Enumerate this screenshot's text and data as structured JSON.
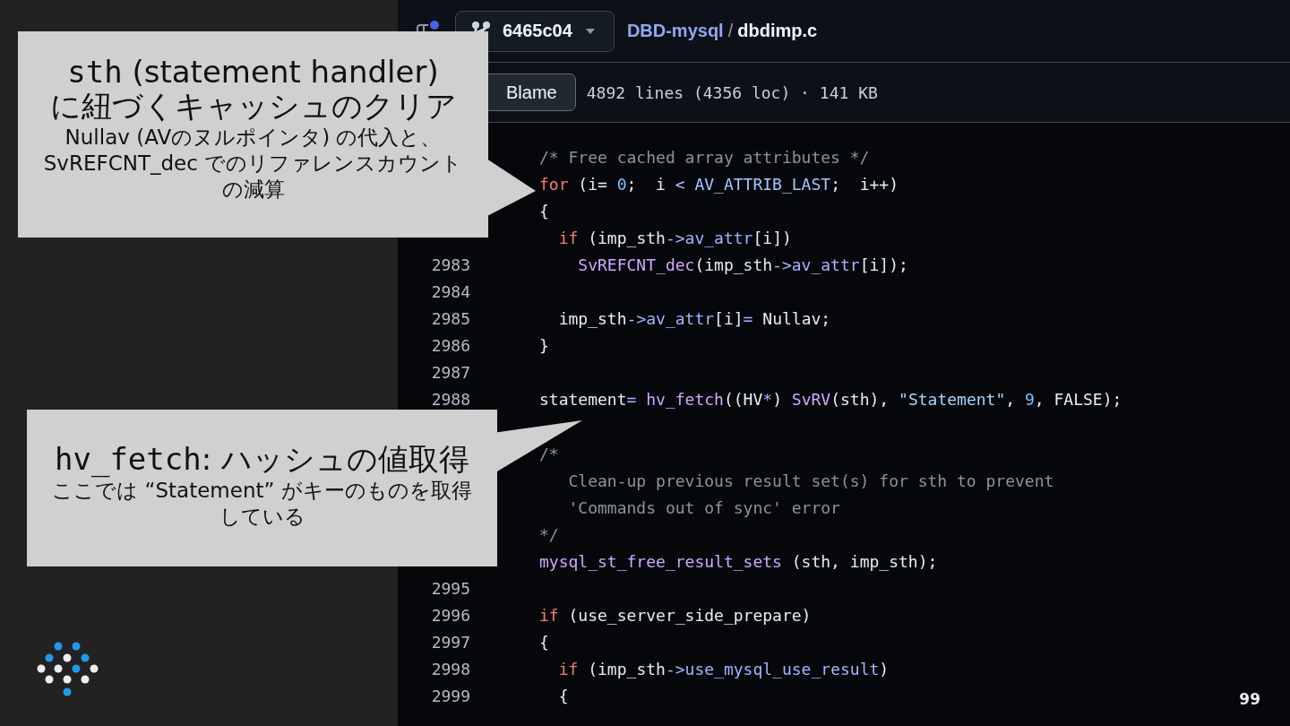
{
  "header": {
    "branch": "6465c04",
    "repo": "DBD-mysql",
    "separator": "/",
    "file": "dbdimp.c"
  },
  "file_bar": {
    "blame_button": "Blame",
    "info": "4892 lines (4356 loc) · 141 KB"
  },
  "code_lines": [
    {
      "tokens": [
        {
          "kind": "comment",
          "text": "/* Free cached array attributes */"
        }
      ]
    },
    {
      "tokens": [
        {
          "kind": "kw",
          "text": "for"
        },
        {
          "kind": "plain",
          "text": " (i= "
        },
        {
          "kind": "num",
          "text": "0"
        },
        {
          "kind": "plain",
          "text": ";  i "
        },
        {
          "kind": "const",
          "text": "< AV_ATTRIB_LAST"
        },
        {
          "kind": "plain",
          "text": ";  i++)"
        }
      ]
    },
    {
      "tokens": [
        {
          "kind": "plain",
          "text": "{"
        }
      ]
    },
    {
      "tokens": [
        {
          "kind": "kw",
          "text": "  if"
        },
        {
          "kind": "plain",
          "text": " (imp_sth"
        },
        {
          "kind": "prop",
          "text": "->av_attr"
        },
        {
          "kind": "plain",
          "text": "[i])"
        }
      ]
    },
    {
      "num": "2983",
      "tokens": [
        {
          "kind": "fn",
          "text": "    SvREFCNT_dec"
        },
        {
          "kind": "plain",
          "text": "(imp_sth"
        },
        {
          "kind": "prop",
          "text": "->av_attr"
        },
        {
          "kind": "plain",
          "text": "[i]);"
        }
      ]
    },
    {
      "num": "2984"
    },
    {
      "num": "2985",
      "tokens": [
        {
          "kind": "plain",
          "text": "  imp_sth"
        },
        {
          "kind": "prop",
          "text": "->av_attr"
        },
        {
          "kind": "plain",
          "text": "[i]"
        },
        {
          "kind": "prop",
          "text": "="
        },
        {
          "kind": "plain",
          "text": " Nullav;"
        }
      ]
    },
    {
      "num": "2986",
      "tokens": [
        {
          "kind": "plain",
          "text": "}"
        }
      ]
    },
    {
      "num": "2987"
    },
    {
      "num": "2988",
      "tokens": [
        {
          "kind": "plain",
          "text": "statement"
        },
        {
          "kind": "prop",
          "text": "="
        },
        {
          "kind": "fn",
          "text": " hv_fetch"
        },
        {
          "kind": "plain",
          "text": "((HV"
        },
        {
          "kind": "prop",
          "text": "*"
        },
        {
          "kind": "plain",
          "text": ") "
        },
        {
          "kind": "fn",
          "text": "SvRV"
        },
        {
          "kind": "plain",
          "text": "(sth), "
        },
        {
          "kind": "str",
          "text": "\"Statement\""
        },
        {
          "kind": "plain",
          "text": ", "
        },
        {
          "kind": "num",
          "text": "9"
        },
        {
          "kind": "plain",
          "text": ", FALSE);"
        }
      ]
    },
    {
      "tokens": [
        {
          "kind": "comment",
          "text": "/*"
        }
      ]
    },
    {
      "tokens": [
        {
          "kind": "comment",
          "text": "   Clean-up previous result set(s) for sth to prevent"
        }
      ]
    },
    {
      "tokens": [
        {
          "kind": "comment",
          "text": "   'Commands out of sync' error"
        }
      ]
    },
    {
      "tokens": [
        {
          "kind": "comment",
          "text": "*/"
        }
      ]
    },
    {
      "tokens": [
        {
          "kind": "fn",
          "text": "mysql_st_free_result_sets"
        },
        {
          "kind": "plain",
          "text": " (sth, imp_sth);"
        }
      ]
    },
    {
      "num": "2995"
    },
    {
      "num": "2996",
      "tokens": [
        {
          "kind": "kw",
          "text": "if"
        },
        {
          "kind": "plain",
          "text": " (use_server_side_prepare)"
        }
      ]
    },
    {
      "num": "2997",
      "tokens": [
        {
          "kind": "plain",
          "text": "{"
        }
      ]
    },
    {
      "num": "2998",
      "tokens": [
        {
          "kind": "kw",
          "text": "  if"
        },
        {
          "kind": "plain",
          "text": " (imp_sth"
        },
        {
          "kind": "prop",
          "text": "->use_mysql_use_result"
        },
        {
          "kind": "plain",
          "text": ")"
        }
      ]
    },
    {
      "num": "2999",
      "tokens": [
        {
          "kind": "plain",
          "text": "  {"
        }
      ]
    }
  ],
  "callouts": [
    {
      "title_lines": [
        [
          {
            "kind": "code",
            "text": "sth"
          },
          {
            "kind": "text",
            "text": " (statement handler)"
          }
        ],
        [
          {
            "kind": "text",
            "text": "に紐づくキャッシュのクリア"
          }
        ]
      ],
      "body": "Nullav (AVのヌルポインタ) の代入と、SvREFCNT_dec でのリファレンスカウントの減算"
    },
    {
      "title_lines": [
        [
          {
            "kind": "code",
            "text": "hv_fetch"
          },
          {
            "kind": "text",
            "text": ": ハッシュの値取得"
          }
        ]
      ],
      "body": "ここでは “Statement” がキーのものを取得している"
    }
  ],
  "page_number": "99"
}
